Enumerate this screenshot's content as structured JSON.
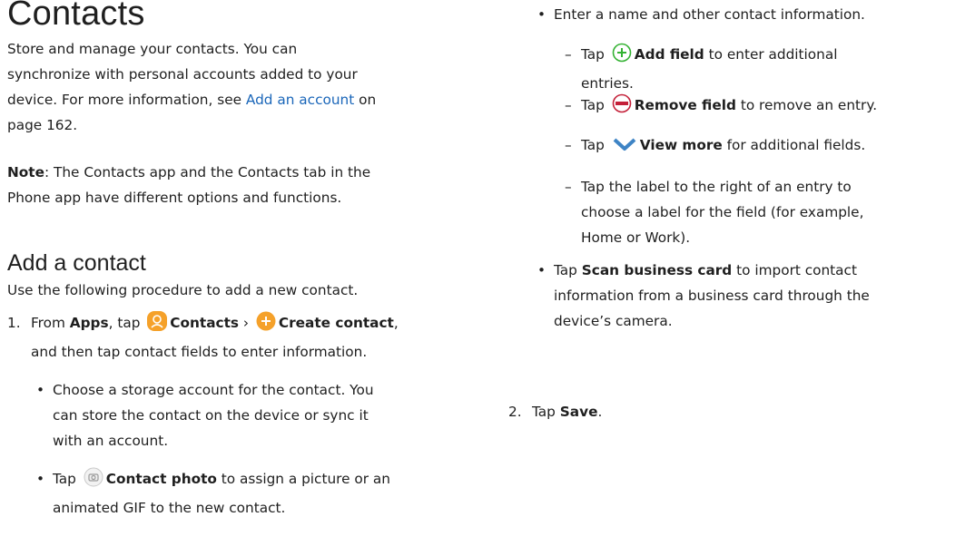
{
  "left": {
    "title": "Contacts",
    "intro_1": "Store and manage your contacts. You can",
    "intro_2": "synchronize with personal accounts added to your",
    "intro_3a": "device. For more information, see ",
    "intro_3_link": "Add an account",
    "intro_3b": " on",
    "intro_4": "page 162.",
    "note_label": "Note",
    "note_1": ": The Contacts app and the Contacts tab in the",
    "note_2": "Phone app have different options and functions.",
    "section_title": "Add a contact",
    "procedure_intro": "Use the following procedure to add a new contact.",
    "step1_num": "1.",
    "step1_a": "From ",
    "step1_apps": "Apps",
    "step1_b": ", tap",
    "step1_contacts": "Contacts",
    "step1_sep": " › ",
    "step1_create": "Create contact",
    "step1_c": ",",
    "step1_d": "and then tap contact fields to enter information.",
    "b1_1": "Choose a storage account for the contact. You",
    "b1_2": "can store the contact on the device or sync it",
    "b1_3": "with an account.",
    "b2_a": "Tap",
    "b2_bold": "Contact photo",
    "b2_b": " to assign a picture or an",
    "b2_2": "animated GIF to the new contact."
  },
  "right": {
    "b3": "Enter a name and other contact information.",
    "d1_a": "Tap",
    "d1_bold": "Add field",
    "d1_b": " to enter additional",
    "d1_2": "entries.",
    "d2_a": "Tap",
    "d2_bold": "Remove field",
    "d2_b": " to remove an entry.",
    "d3_a": "Tap",
    "d3_bold": "View more",
    "d3_b": " for additional fields.",
    "d4_1": "Tap the label to the right of an entry to",
    "d4_2": "choose a label for the field (for example,",
    "d4_3": "Home or Work).",
    "b4_a": "Tap ",
    "b4_bold": "Scan business card",
    "b4_b": " to import contact",
    "b4_2": "information from a business card through the",
    "b4_3": "device’s camera.",
    "step2_num": "2.",
    "step2_a": "Tap ",
    "step2_bold": "Save",
    "step2_b": "."
  },
  "icons": {
    "contacts_app": "contacts-app-icon",
    "create_contact": "plus-circle-orange-icon",
    "contact_photo": "camera-circle-icon",
    "add_field": "plus-circle-green-icon",
    "remove_field": "minus-circle-red-icon",
    "view_more": "chevron-down-icon"
  },
  "colors": {
    "link": "#1a66b9",
    "orange": "#f5a12a",
    "green": "#34b233",
    "red": "#c4213a",
    "chevron": "#3e84c5"
  }
}
